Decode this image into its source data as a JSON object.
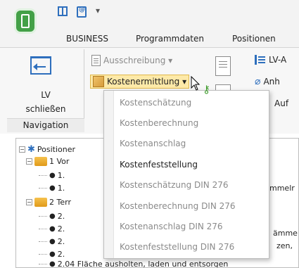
{
  "window": {
    "qat_dropdown": "▾"
  },
  "tabs": [
    "BUSINESS",
    "Programmdaten",
    "Positionen"
  ],
  "ribbon": {
    "lv_close_line1": "LV",
    "lv_close_line2": "schließen",
    "group_navigation": "Navigation",
    "ausschreibung": "Ausschreibung ▾",
    "kostenermittlung": "Kostenermittlung ▾",
    "lv_a": "LV-A",
    "anh": "Anh",
    "auf": "Auf"
  },
  "menu": {
    "items": [
      {
        "label": "Kostenschätzung",
        "active": false
      },
      {
        "label": "Kostenberechnung",
        "active": false
      },
      {
        "label": "Kostenanschlag",
        "active": false
      },
      {
        "label": "Kostenfeststellung",
        "active": true
      },
      {
        "label": "Kostenschätzung DIN 276",
        "active": false
      },
      {
        "label": "Kostenberechnung DIN 276",
        "active": false
      },
      {
        "label": "Kostenanschlag DIN 276",
        "active": false
      },
      {
        "label": "Kostenfeststellung DIN 276",
        "active": false
      }
    ]
  },
  "tree": {
    "root": "Positioner",
    "folder1": "1 Vor",
    "item_1a": "1.",
    "item_1b": "1.",
    "folder2": "2 Terr",
    "item_2a": "2.",
    "item_2b": "2.",
    "item_2c": "2.",
    "item_2d": "2.",
    "item_2e": "2.04 Fläche ausholten, laden und entsorgen",
    "right_1": "mmelr",
    "right_2": "ämme",
    "right_3": "zen,",
    "collapse": "−"
  },
  "icons": {
    "bullet": "●"
  }
}
